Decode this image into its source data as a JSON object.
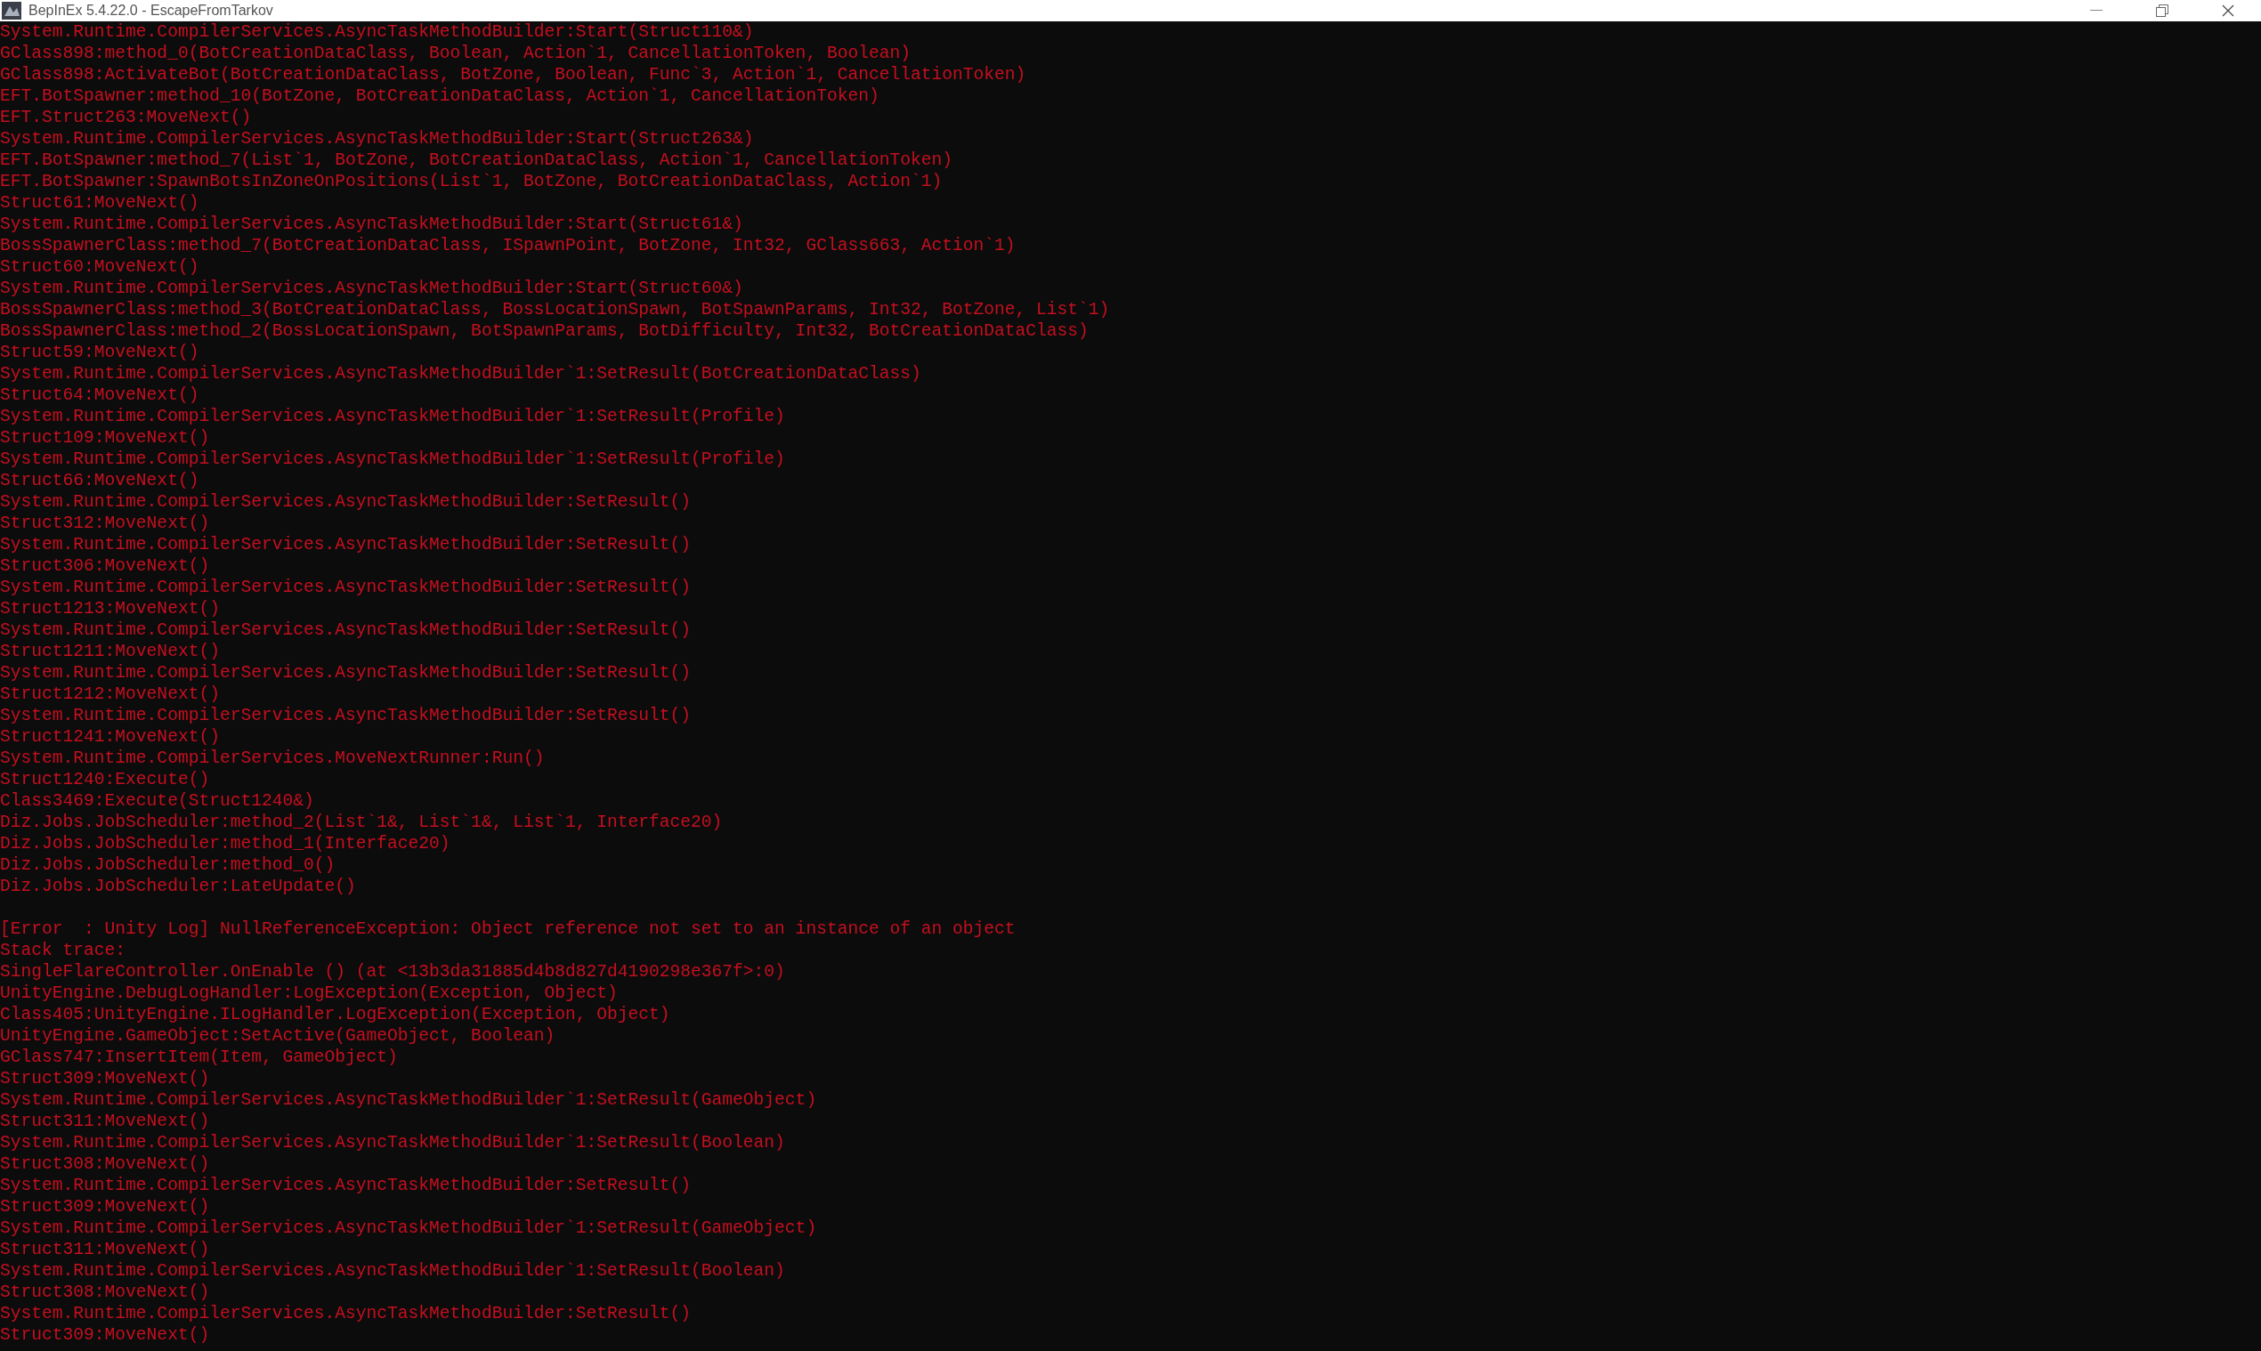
{
  "window": {
    "title": "BepInEx 5.4.22.0 - EscapeFromTarkov"
  },
  "console": {
    "blocks": [
      [
        "System.Runtime.CompilerServices.AsyncTaskMethodBuilder:Start(Struct110&)",
        "GClass898:method_0(BotCreationDataClass, Boolean, Action`1, CancellationToken, Boolean)",
        "GClass898:ActivateBot(BotCreationDataClass, BotZone, Boolean, Func`3, Action`1, CancellationToken)",
        "EFT.BotSpawner:method_10(BotZone, BotCreationDataClass, Action`1, CancellationToken)",
        "EFT.Struct263:MoveNext()",
        "System.Runtime.CompilerServices.AsyncTaskMethodBuilder:Start(Struct263&)",
        "EFT.BotSpawner:method_7(List`1, BotZone, BotCreationDataClass, Action`1, CancellationToken)",
        "EFT.BotSpawner:SpawnBotsInZoneOnPositions(List`1, BotZone, BotCreationDataClass, Action`1)",
        "Struct61:MoveNext()",
        "System.Runtime.CompilerServices.AsyncTaskMethodBuilder:Start(Struct61&)",
        "BossSpawnerClass:method_7(BotCreationDataClass, ISpawnPoint, BotZone, Int32, GClass663, Action`1)",
        "Struct60:MoveNext()",
        "System.Runtime.CompilerServices.AsyncTaskMethodBuilder:Start(Struct60&)",
        "BossSpawnerClass:method_3(BotCreationDataClass, BossLocationSpawn, BotSpawnParams, Int32, BotZone, List`1)",
        "BossSpawnerClass:method_2(BossLocationSpawn, BotSpawnParams, BotDifficulty, Int32, BotCreationDataClass)",
        "Struct59:MoveNext()",
        "System.Runtime.CompilerServices.AsyncTaskMethodBuilder`1:SetResult(BotCreationDataClass)",
        "Struct64:MoveNext()",
        "System.Runtime.CompilerServices.AsyncTaskMethodBuilder`1:SetResult(Profile)",
        "Struct109:MoveNext()",
        "System.Runtime.CompilerServices.AsyncTaskMethodBuilder`1:SetResult(Profile)",
        "Struct66:MoveNext()",
        "System.Runtime.CompilerServices.AsyncTaskMethodBuilder:SetResult()",
        "Struct312:MoveNext()",
        "System.Runtime.CompilerServices.AsyncTaskMethodBuilder:SetResult()",
        "Struct306:MoveNext()",
        "System.Runtime.CompilerServices.AsyncTaskMethodBuilder:SetResult()",
        "Struct1213:MoveNext()",
        "System.Runtime.CompilerServices.AsyncTaskMethodBuilder:SetResult()",
        "Struct1211:MoveNext()",
        "System.Runtime.CompilerServices.AsyncTaskMethodBuilder:SetResult()",
        "Struct1212:MoveNext()",
        "System.Runtime.CompilerServices.AsyncTaskMethodBuilder:SetResult()",
        "Struct1241:MoveNext()",
        "System.Runtime.CompilerServices.MoveNextRunner:Run()",
        "Struct1240:Execute()",
        "Class3469:Execute(Struct1240&)",
        "Diz.Jobs.JobScheduler:method_2(List`1&, List`1&, List`1, Interface20)",
        "Diz.Jobs.JobScheduler:method_1(Interface20)",
        "Diz.Jobs.JobScheduler:method_0()",
        "Diz.Jobs.JobScheduler:LateUpdate()"
      ],
      [
        "[Error  : Unity Log] NullReferenceException: Object reference not set to an instance of an object",
        "Stack trace:",
        "SingleFlareController.OnEnable () (at <13b3da31885d4b8d827d4190298e367f>:0)",
        "UnityEngine.DebugLogHandler:LogException(Exception, Object)",
        "Class405:UnityEngine.ILogHandler.LogException(Exception, Object)",
        "UnityEngine.GameObject:SetActive(GameObject, Boolean)",
        "GClass747:InsertItem(Item, GameObject)",
        "Struct309:MoveNext()",
        "System.Runtime.CompilerServices.AsyncTaskMethodBuilder`1:SetResult(GameObject)",
        "Struct311:MoveNext()",
        "System.Runtime.CompilerServices.AsyncTaskMethodBuilder`1:SetResult(Boolean)",
        "Struct308:MoveNext()",
        "System.Runtime.CompilerServices.AsyncTaskMethodBuilder:SetResult()",
        "Struct309:MoveNext()",
        "System.Runtime.CompilerServices.AsyncTaskMethodBuilder`1:SetResult(GameObject)",
        "Struct311:MoveNext()",
        "System.Runtime.CompilerServices.AsyncTaskMethodBuilder`1:SetResult(Boolean)",
        "Struct308:MoveNext()",
        "System.Runtime.CompilerServices.AsyncTaskMethodBuilder:SetResult()",
        "Struct309:MoveNext()"
      ]
    ]
  }
}
